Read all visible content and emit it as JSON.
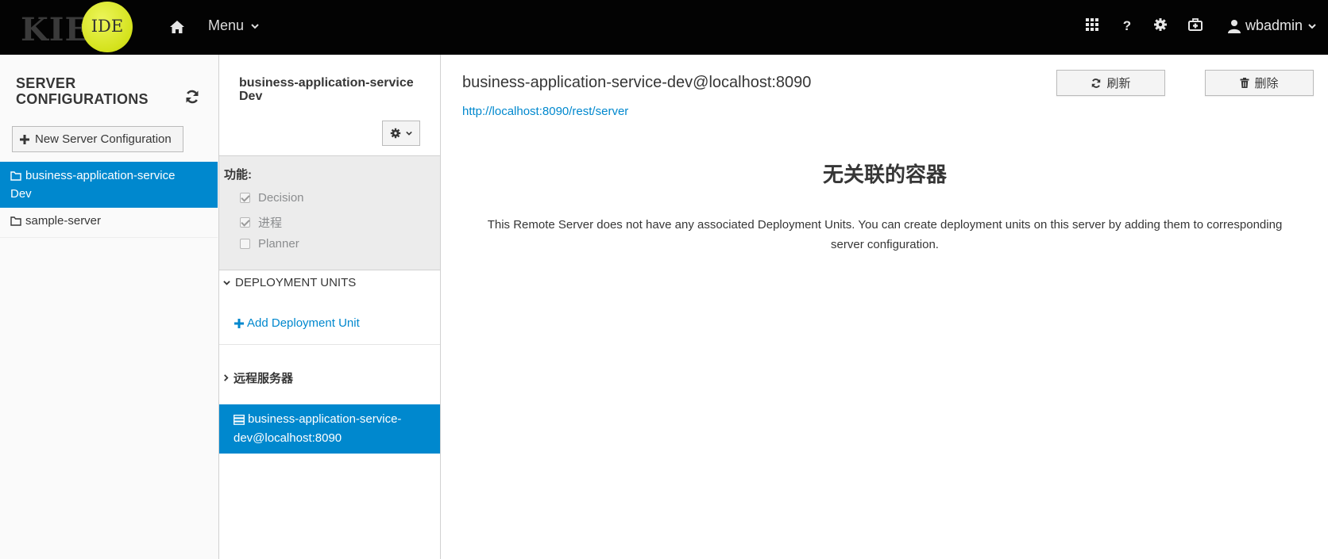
{
  "topbar": {
    "logo_text": "KIE",
    "logo_badge": "IDE",
    "menu_label": "Menu",
    "user_name": "wbadmin",
    "icons": [
      "home-icon",
      "apps-grid-icon",
      "help-icon",
      "settings-gear-icon",
      "tasks-briefcase-icon",
      "user-icon"
    ],
    "help_glyph": "?"
  },
  "left_panel": {
    "title_line1": "SERVER",
    "title_line2": "CONFIGURATIONS",
    "new_button_label": "New Server Configuration",
    "items": [
      {
        "line1": "business-application-service",
        "line2": "Dev",
        "active": true
      },
      {
        "line1": "sample-server",
        "line2": "",
        "active": false
      }
    ]
  },
  "middle_panel": {
    "title_line1": "business-application-service",
    "title_line2": "Dev",
    "capabilities_label": "功能:",
    "capabilities": [
      {
        "label": "Decision",
        "checked": true
      },
      {
        "label": "进程",
        "checked": true
      },
      {
        "label": "Planner",
        "checked": false
      }
    ],
    "deployment_units_label": "DEPLOYMENT UNITS",
    "add_deployment_unit_label": "Add Deployment Unit",
    "remote_servers_label": "远程服务器",
    "remote_server_line1": "business-application-service-",
    "remote_server_line2": "dev@localhost:8090"
  },
  "content": {
    "server_heading": "business-application-service-dev@localhost:8090",
    "server_url": "http://localhost:8090/rest/server",
    "refresh_label": "刷新",
    "delete_label": "删除",
    "empty_title": "无关联的容器",
    "empty_text_line1": "This Remote Server does not have any associated Deployment Units. You can create deployment units on this server by adding them to corresponding",
    "empty_text_line2": "server configuration."
  },
  "colors": {
    "topbar_bg": "#030303",
    "accent_blue": "#0088ce",
    "logo_ball": "#d4e21c"
  }
}
